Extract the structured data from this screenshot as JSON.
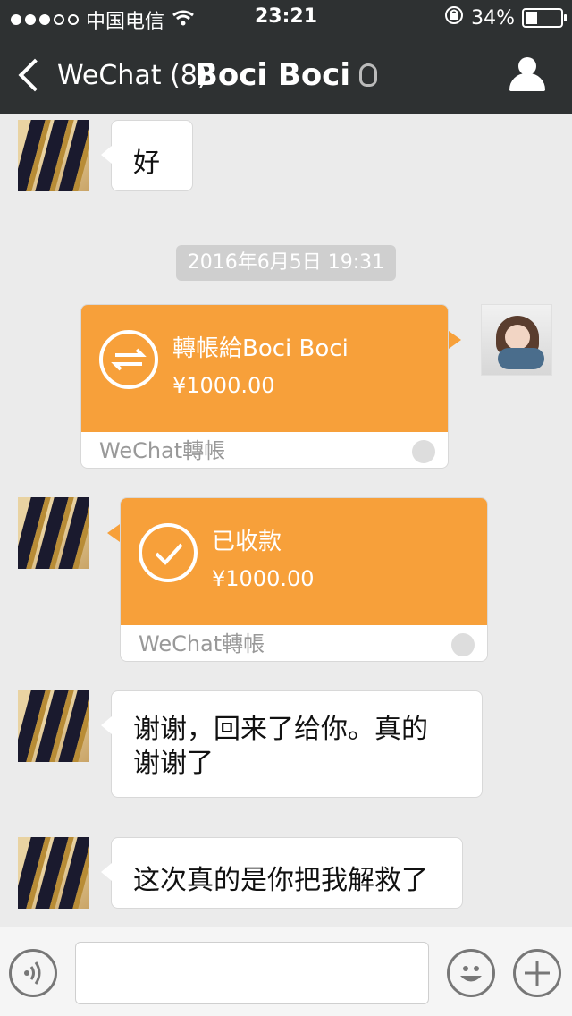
{
  "status": {
    "carrier": "中国电信",
    "time": "23:21",
    "battery": "34%",
    "battery_level": 0.34
  },
  "nav": {
    "back_label": "WeChat (8)",
    "title": "Boci Boci"
  },
  "messages": [
    {
      "text": "好"
    },
    {
      "timestamp": "2016年6月5日 19:31"
    },
    {
      "transfer_title": "轉帳給Boci Boci",
      "amount": "¥1000.00",
      "footer": "WeChat轉帳"
    },
    {
      "transfer_title": "已收款",
      "amount": "¥1000.00",
      "footer": "WeChat轉帳"
    },
    {
      "text_line1": "谢谢，回来了给你。真的",
      "text_line2": "谢谢了"
    },
    {
      "text": "这次真的是你把我解救了"
    }
  ],
  "input": {
    "placeholder": ""
  },
  "icons": {
    "voice": "voice-icon",
    "emoji": "emoji-icon",
    "plus": "plus-icon"
  },
  "colors": {
    "nav_bg": "#2e3132",
    "bg": "#ebebeb",
    "transfer": "#f7a03a"
  }
}
